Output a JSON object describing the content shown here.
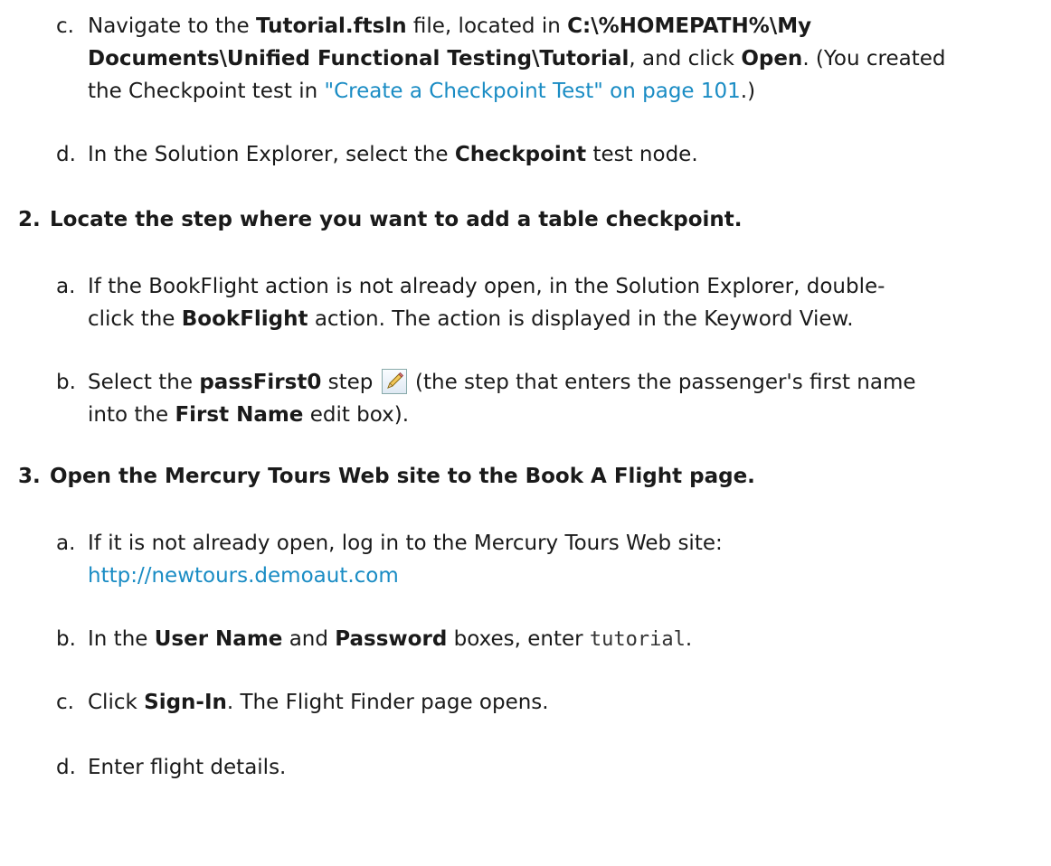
{
  "c1": {
    "marker": "c.",
    "l1_a": "Navigate to the ",
    "l1_b": "Tutorial.ftsln",
    "l1_c": " file, located in ",
    "l1_d": "C:\\%HOMEPATH%\\My",
    "l2_a": "Documents\\Unified Functional Testing\\Tutorial",
    "l2_b": ", and click ",
    "l2_c": "Open",
    "l2_d": ". (You created",
    "l3_a": "the Checkpoint test in ",
    "l3_link": "\"Create a Checkpoint Test\" on page 101",
    "l3_b": ".)"
  },
  "d1": {
    "marker": "d.",
    "a": "In the Solution Explorer, select the ",
    "b": "Checkpoint",
    "c": " test node."
  },
  "step2": {
    "num": "2.",
    "title": "Locate the step where you want to add a table checkpoint."
  },
  "s2a": {
    "marker": "a.",
    "l1": "If the BookFlight action is not already open, in the Solution Explorer, double-",
    "l2_a": "click the ",
    "l2_b": "BookFlight",
    "l2_c": " action. The action is displayed in the Keyword View."
  },
  "s2b": {
    "marker": "b.",
    "l1_a": "Select the ",
    "l1_b": "passFirst0",
    "l1_c": " step ",
    "l1_d": " (the step that enters the passenger's first name",
    "l2_a": "into the ",
    "l2_b": "First Name",
    "l2_c": " edit box).",
    "icon": "pencil-edit-icon"
  },
  "step3": {
    "num": "3.",
    "title": "Open the Mercury Tours Web site to the Book A Flight page."
  },
  "s3a": {
    "marker": "a.",
    "l1": "If it is not already open, log in to the Mercury Tours Web site:",
    "link": "http://newtours.demoaut.com"
  },
  "s3b": {
    "marker": "b.",
    "a": "In the ",
    "b": "User Name",
    "c": " and ",
    "d": "Password",
    "e": " boxes, enter ",
    "f": "tutorial",
    "g": "."
  },
  "s3c": {
    "marker": "c.",
    "a": "Click ",
    "b": "Sign-In",
    "c": ". The Flight Finder page opens."
  },
  "s3d": {
    "marker": "d.",
    "a": "Enter flight details."
  },
  "colors": {
    "link": "#1a8cc4",
    "text": "#1a1a1a"
  }
}
